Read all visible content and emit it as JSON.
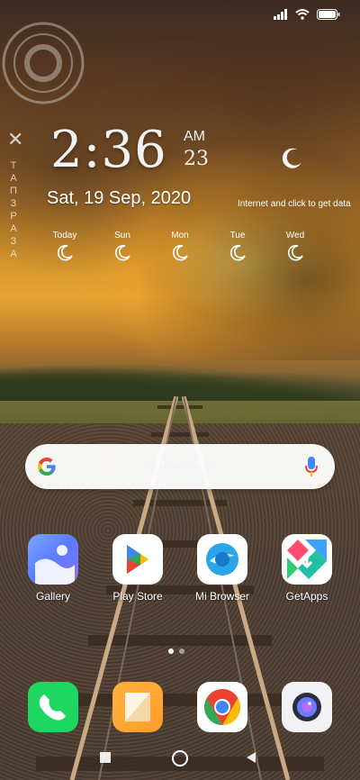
{
  "widget": {
    "vertical_text": "ТАПЗРАЗА",
    "time": "2:36",
    "ampm": "AM",
    "seconds": "23",
    "date": "Sat, 19 Sep, 2020",
    "internet_note": "Internet and click to get data",
    "forecast": [
      {
        "label": "Today"
      },
      {
        "label": "Sun"
      },
      {
        "label": "Mon"
      },
      {
        "label": "Tue"
      },
      {
        "label": "Wed"
      }
    ]
  },
  "apps": {
    "row1": [
      {
        "label": "Gallery",
        "icon": "gallery-icon"
      },
      {
        "label": "Play Store",
        "icon": "play-store-icon"
      },
      {
        "label": "Mi Browser",
        "icon": "mi-browser-icon"
      },
      {
        "label": "GetApps",
        "icon": "getapps-icon"
      }
    ],
    "dock": [
      {
        "icon": "phone-icon"
      },
      {
        "icon": "notes-icon"
      },
      {
        "icon": "chrome-icon"
      },
      {
        "icon": "camera-icon"
      }
    ]
  },
  "search": {
    "icon_left": "google-icon",
    "icon_right": "microphone-icon"
  },
  "page_indicator": {
    "count": 2,
    "active": 1
  },
  "colors": {
    "accent_blue": "#4285F4",
    "green": "#34A853",
    "red": "#EA4335",
    "yellow": "#FBBC05"
  }
}
